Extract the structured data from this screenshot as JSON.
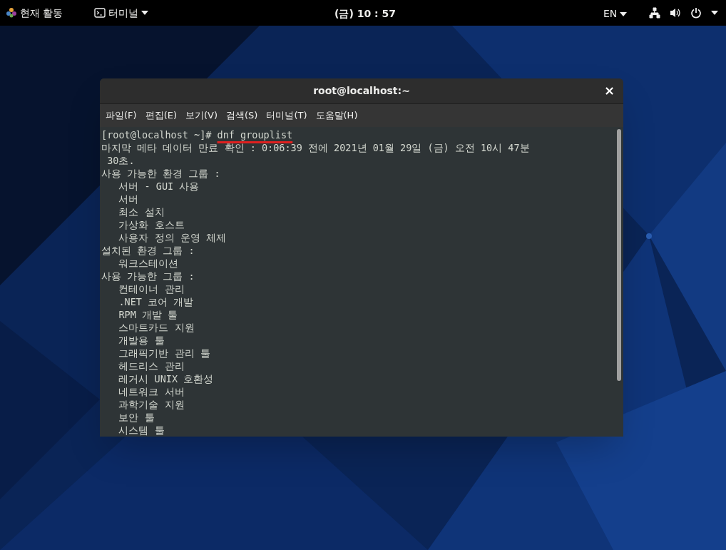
{
  "top_bar": {
    "activities": "현재 활동",
    "app_menu": "터미널",
    "clock": "(금) 10 : 57",
    "language": "EN"
  },
  "window": {
    "title": "root@localhost:~",
    "close": "×"
  },
  "menu": [
    {
      "label": "파일(F)"
    },
    {
      "label": "편집(E)"
    },
    {
      "label": "보기(V)"
    },
    {
      "label": "검색(S)"
    },
    {
      "label": "터미널(T)"
    },
    {
      "label": "도움말(H)"
    }
  ],
  "terminal": {
    "prompt": "[root@localhost ~]# ",
    "command": "dnf grouplist",
    "command_underlined": true,
    "lines": [
      {
        "text": "마지막 메타 데이터 만료 확인 : 0:06:39 전에 2021년 01월 29일 (금) 오전 10시 47분"
      },
      {
        "text": " 30초."
      },
      {
        "text": "사용 가능한 환경 그룹 :"
      },
      {
        "text": "   서버 - GUI 사용"
      },
      {
        "text": "   서버"
      },
      {
        "text": "   최소 설치"
      },
      {
        "text": "   가상화 호스트"
      },
      {
        "text": "   사용자 정의 운영 체제"
      },
      {
        "text": "설치된 환경 그룹 :"
      },
      {
        "text": "   워크스테이션"
      },
      {
        "text": "사용 가능한 그룹 :"
      },
      {
        "text": "   컨테이너 관리"
      },
      {
        "text": "   .NET 코어 개발"
      },
      {
        "text": "   RPM 개발 툴"
      },
      {
        "text": "   스마트카드 지원"
      },
      {
        "text": "   개발용 툴"
      },
      {
        "text": "   그래픽기반 관리 툴"
      },
      {
        "text": "   헤드리스 관리"
      },
      {
        "text": "   레거시 UNIX 호환성"
      },
      {
        "text": "   네트워크 서버"
      },
      {
        "text": "   과학기술 지원"
      },
      {
        "text": "   보안 툴"
      },
      {
        "text": "   시스템 툴"
      }
    ]
  }
}
